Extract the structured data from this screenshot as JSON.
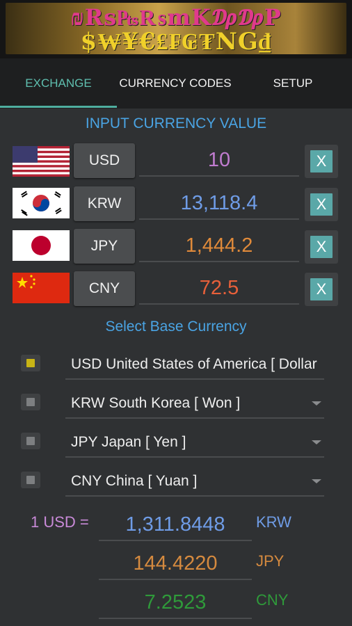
{
  "banner": {
    "line1": "₪Rs₧₨mK₯₯P",
    "line2": "$₩¥€₤₣₢₮NG₫"
  },
  "tabs": [
    {
      "label": "EXCHANGE",
      "active": true
    },
    {
      "label": "CURRENCY CODES",
      "active": false
    },
    {
      "label": "SETUP",
      "active": false
    }
  ],
  "input_section": {
    "title": "INPUT CURRENCY VALUE",
    "rows": [
      {
        "flag": "us-flag",
        "code": "USD",
        "value": "10",
        "color": "#c07ccf",
        "clear": "X"
      },
      {
        "flag": "kr-flag",
        "code": "KRW",
        "value": "13,118.4",
        "color": "#6f9ce6",
        "clear": "X"
      },
      {
        "flag": "jp-flag",
        "code": "JPY",
        "value": "1,444.2",
        "color": "#e08a3a",
        "clear": "X"
      },
      {
        "flag": "cn-flag",
        "code": "CNY",
        "value": "72.5",
        "color": "#e8603a",
        "clear": "X"
      }
    ]
  },
  "base_section": {
    "title": "Select Base Currency",
    "items": [
      {
        "label": "USD  United States of America [ Dollar ]",
        "selected": true
      },
      {
        "label": "KRW  South Korea [ Won ]",
        "selected": false
      },
      {
        "label": "JPY  Japan [ Yen ]",
        "selected": false
      },
      {
        "label": "CNY  China [ Yuan ]",
        "selected": false
      }
    ]
  },
  "rates": {
    "prefix": "1 USD =",
    "rows": [
      {
        "value": "1,311.8448",
        "code": "KRW",
        "color": "#6f9ce6"
      },
      {
        "value": "144.4220",
        "code": "JPY",
        "color": "#d58a3f"
      },
      {
        "value": "7.2523",
        "code": "CNY",
        "color": "#2f9a3a"
      }
    ]
  }
}
